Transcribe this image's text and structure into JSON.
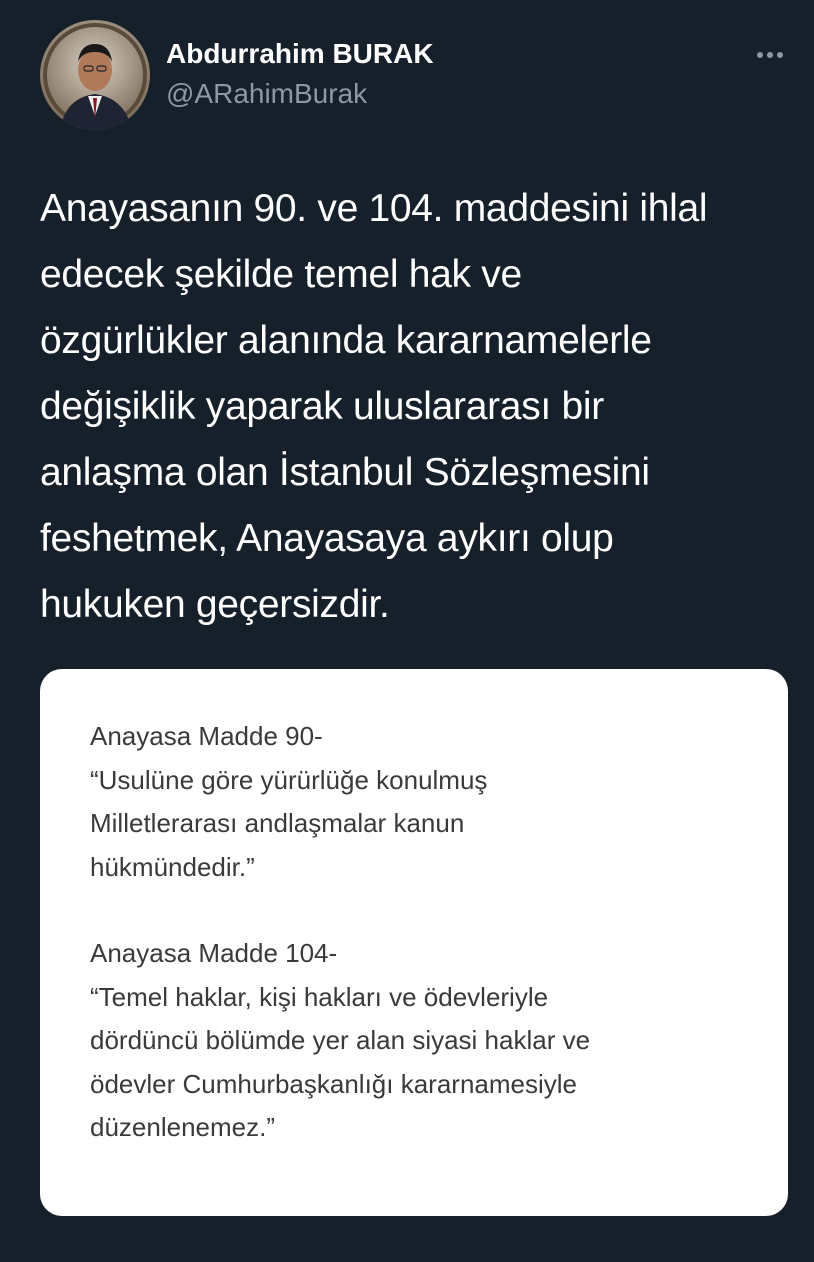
{
  "author": {
    "name": "Abdurrahim BURAK",
    "handle": "@ARahimBurak",
    "avatar_icon": "profile-photo"
  },
  "menu_icon": "more-horizontal-icon",
  "tweet": {
    "lines": [
      "Anayasanın 90. ve 104. maddesini ihlal",
      "edecek şekilde temel hak ve",
      "özgürlükler alanında kararnamelerle",
      "değişiklik yaparak uluslararası bir",
      "anlaşma olan İstanbul Sözleşmesini",
      "feshetmek, Anayasaya aykırı olup",
      "hukuken geçersizdir."
    ]
  },
  "image_card": {
    "block1": [
      "Anayasa Madde 90-",
      "“Usulüne göre yürürlüğe konulmuş",
      "Milletlerarası andlaşmalar kanun",
      "hükmündedir.”"
    ],
    "block2": [
      "Anayasa Madde 104-",
      "“Temel haklar, kişi hakları ve ödevleriyle",
      "dördüncü bölümde yer alan siyasi haklar ve",
      "ödevler Cumhurbaşkanlığı kararnamesiyle",
      "düzenlenemez.”"
    ]
  },
  "colors": {
    "background": "#15202b",
    "secondary_text": "#8b98a5",
    "card_background": "#ffffff",
    "card_text": "#3a3a3c"
  }
}
